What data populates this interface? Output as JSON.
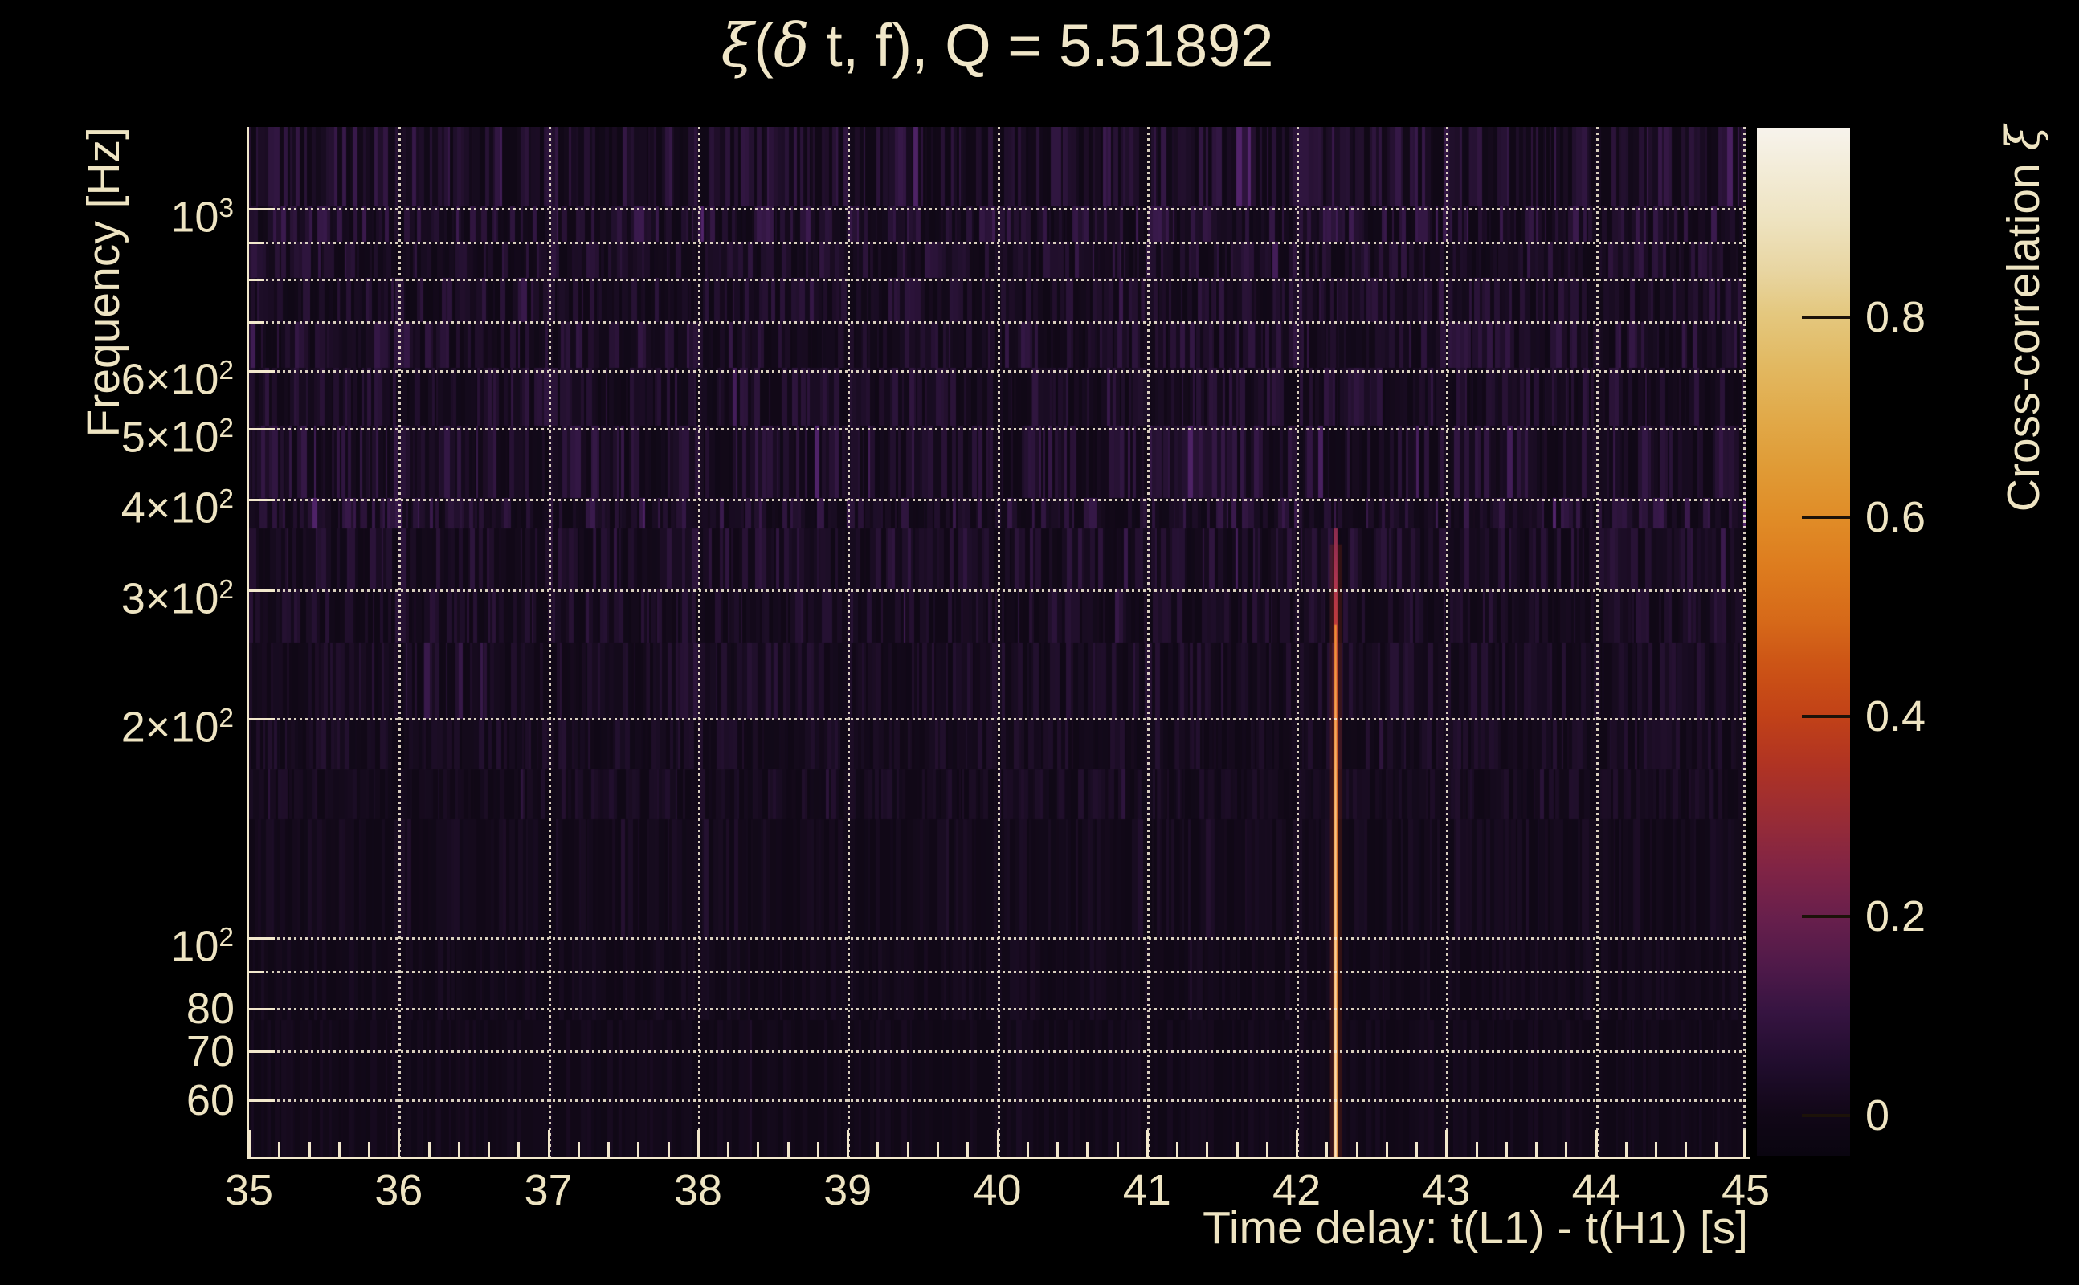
{
  "figure": {
    "title": {
      "full": "ξ(δ t, f), Q = 5.51892",
      "segments": [
        {
          "text": "ξ",
          "greek": true
        },
        {
          "text": "(",
          "greek": false
        },
        {
          "text": "δ",
          "greek": true
        },
        {
          "text": " t, f), Q = 5.51892",
          "greek": false
        }
      ]
    },
    "x_axis": {
      "label": "Time delay: t(L1) - t(H1) [s]",
      "range": [
        35,
        45
      ],
      "major_ticks": [
        35,
        36,
        37,
        38,
        39,
        40,
        41,
        42,
        43,
        44,
        45
      ],
      "minor_step": 0.2
    },
    "y_axis": {
      "label": "Frequency [Hz]",
      "scale": "log",
      "range_hz": [
        50.2,
        1296
      ],
      "labeled_ticks": [
        {
          "hz": 1000,
          "base": "10",
          "exp": "3"
        },
        {
          "hz": 600,
          "base": "6×10",
          "exp": "2"
        },
        {
          "hz": 500,
          "base": "5×10",
          "exp": "2"
        },
        {
          "hz": 400,
          "base": "4×10",
          "exp": "2"
        },
        {
          "hz": 300,
          "base": "3×10",
          "exp": "2"
        },
        {
          "hz": 200,
          "base": "2×10",
          "exp": "2"
        },
        {
          "hz": 100,
          "base": "10",
          "exp": "2"
        },
        {
          "hz": 80,
          "base": "80",
          "exp": ""
        },
        {
          "hz": 70,
          "base": "70",
          "exp": ""
        },
        {
          "hz": 60,
          "base": "60",
          "exp": ""
        }
      ],
      "minor_ticks_hz": [
        900,
        800,
        700,
        90
      ],
      "gridlines_hz": [
        60,
        70,
        80,
        90,
        100,
        200,
        300,
        400,
        500,
        600,
        700,
        800,
        900,
        1000
      ]
    },
    "colorbar": {
      "label": {
        "full": "Cross-correlation ξ",
        "segments": [
          {
            "text": "Cross-correlation ",
            "greek": false
          },
          {
            "text": "ξ",
            "greek": true
          }
        ]
      },
      "value_range": [
        -0.04,
        0.99
      ],
      "ticks": [
        {
          "v": 0.8,
          "label": "0.8"
        },
        {
          "v": 0.6,
          "label": "0.6"
        },
        {
          "v": 0.4,
          "label": "0.4"
        },
        {
          "v": 0.2,
          "label": "0.2"
        },
        {
          "v": 0.0,
          "label": "0"
        }
      ],
      "gradient": [
        {
          "pct": 0,
          "c": "#f7f3ec"
        },
        {
          "pct": 4,
          "c": "#f3ecd8"
        },
        {
          "pct": 9,
          "c": "#eee3c0"
        },
        {
          "pct": 14,
          "c": "#e8d5a1"
        },
        {
          "pct": 18,
          "c": "#e4c87f"
        },
        {
          "pct": 23,
          "c": "#e2b962"
        },
        {
          "pct": 28,
          "c": "#e1aa4a"
        },
        {
          "pct": 33,
          "c": "#e09b36"
        },
        {
          "pct": 38,
          "c": "#e08c27"
        },
        {
          "pct": 43,
          "c": "#dd7b1e"
        },
        {
          "pct": 48,
          "c": "#d66919"
        },
        {
          "pct": 52,
          "c": "#cd5516"
        },
        {
          "pct": 57,
          "c": "#c24217"
        },
        {
          "pct": 62,
          "c": "#b03323"
        },
        {
          "pct": 67,
          "c": "#992c35"
        },
        {
          "pct": 72,
          "c": "#812445"
        },
        {
          "pct": 77,
          "c": "#671f4c"
        },
        {
          "pct": 82,
          "c": "#4d1949"
        },
        {
          "pct": 86,
          "c": "#361441"
        },
        {
          "pct": 91,
          "c": "#210d2e"
        },
        {
          "pct": 96,
          "c": "#110717"
        },
        {
          "pct": 100,
          "c": "#0a0510"
        }
      ]
    },
    "colors": {
      "background": "#000000",
      "text": "#eee4c2",
      "axis": "#f2e8cc",
      "grid": "rgba(243,233,211,0.88)"
    }
  },
  "chart_data": {
    "type": "heatmap",
    "title": "ξ(δ t, f), Q = 5.51892",
    "q_value": 5.51892,
    "xlabel": "Time delay: t(L1) - t(H1) [s]",
    "ylabel": "Frequency [Hz]",
    "colorbar_label": "Cross-correlation ξ",
    "x_range_s": [
      35,
      45
    ],
    "y_range_hz": [
      50.2,
      1296
    ],
    "y_scale": "log",
    "grid": true,
    "colorbar_range": [
      -0.04,
      0.99
    ],
    "noise_floor_xi": 0.05,
    "peak": {
      "time_delay_s": 42.26,
      "freq_span_hz": [
        50.2,
        365
      ],
      "xi_max_approx": 0.95
    },
    "noise_bands": [
      [
        0,
        99,
        0.5
      ],
      [
        99,
        143,
        0.55
      ],
      [
        143,
        188,
        0.42
      ],
      [
        188,
        243,
        0.38
      ],
      [
        243,
        300,
        0.45
      ],
      [
        300,
        372,
        0.4
      ],
      [
        372,
        462,
        0.46
      ],
      [
        462,
        500,
        0.52
      ],
      [
        500,
        575,
        0.4
      ],
      [
        575,
        642,
        0.34
      ],
      [
        642,
        737,
        0.3
      ],
      [
        737,
        800,
        0.26
      ],
      [
        800,
        862,
        0.22
      ],
      [
        862,
        1010,
        0.16
      ],
      [
        1010,
        1112,
        0.12
      ],
      [
        1112,
        1282,
        0.1
      ]
    ]
  }
}
